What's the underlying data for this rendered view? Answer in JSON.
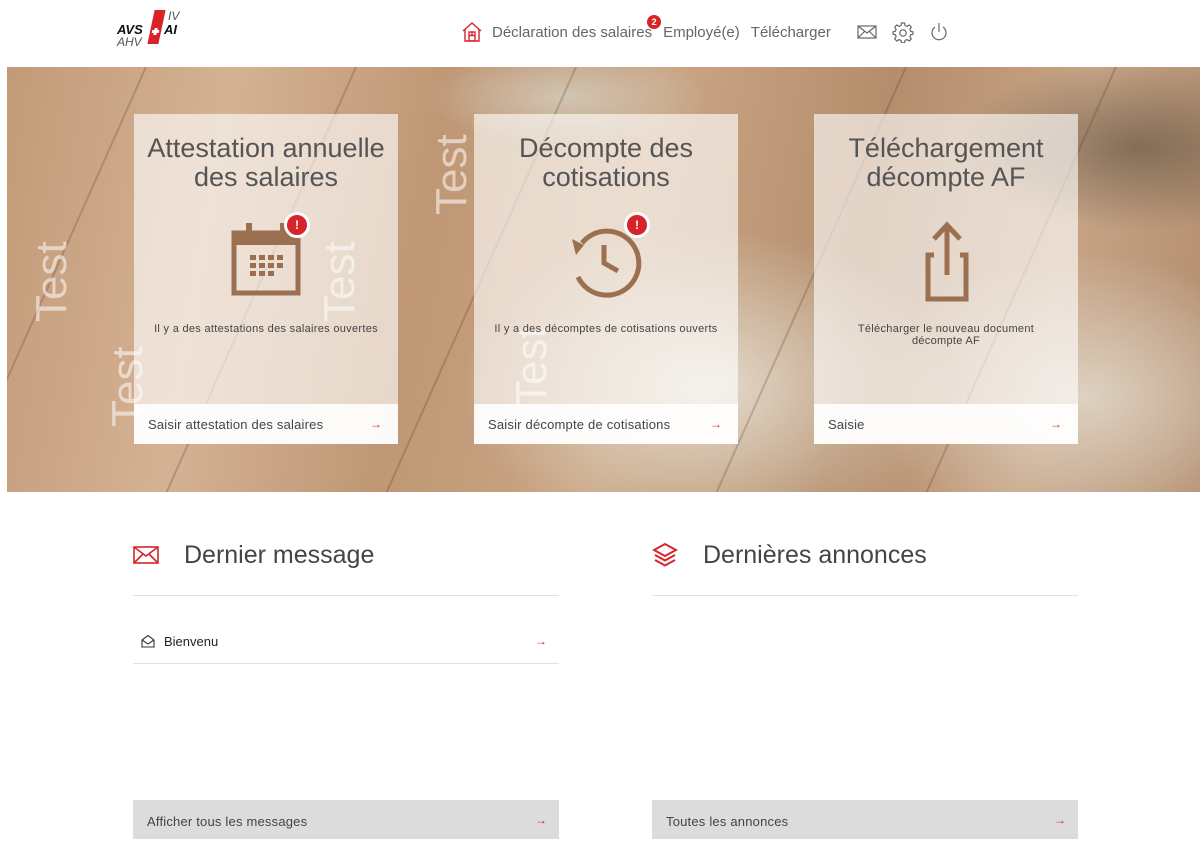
{
  "header": {
    "logo": {
      "avs": "AVS",
      "ai": "AI",
      "ahv": "AHV",
      "iv": "IV"
    },
    "nav": [
      {
        "label": "Déclaration des salaires",
        "icon": "home-icon",
        "badge": "2"
      },
      {
        "label": "Employé(e)"
      },
      {
        "label": "Télécharger"
      }
    ],
    "icons": [
      "mail-icon",
      "settings-icon",
      "power-icon"
    ]
  },
  "hero": {
    "watermark": "Test",
    "cards": [
      {
        "title": "Attestation annuelle des salaires",
        "icon": "calendar-icon",
        "badge": "!",
        "text": "Il y a des attestations des salaires ouvertes",
        "action": "Saisir attestation des salaires",
        "arrow": "→"
      },
      {
        "title": "Décompte des cotisations",
        "icon": "history-clock-icon",
        "badge": "!",
        "text": "Il y a des décomptes de cotisations ouverts",
        "action": "Saisir décompte de cotisations",
        "arrow": "→"
      },
      {
        "title": "Téléchargement décompte AF",
        "icon": "share-upload-icon",
        "text": "Télécharger le nouveau document décompte AF",
        "action": "Saisie",
        "arrow": "→"
      }
    ]
  },
  "messages": {
    "title": "Dernier message",
    "icon": "envelope-icon",
    "items": [
      {
        "label": "Bienvenu",
        "icon": "open-envelope-icon",
        "arrow": "→"
      }
    ],
    "footer": "Afficher tous les messages",
    "footer_arrow": "→"
  },
  "announcements": {
    "title": "Dernières annonces",
    "icon": "layers-icon",
    "footer": "Toutes les annonces",
    "footer_arrow": "→"
  },
  "colors": {
    "accent": "#d8232a",
    "icon_brown": "#9b7051",
    "nav_gray": "#666666"
  }
}
